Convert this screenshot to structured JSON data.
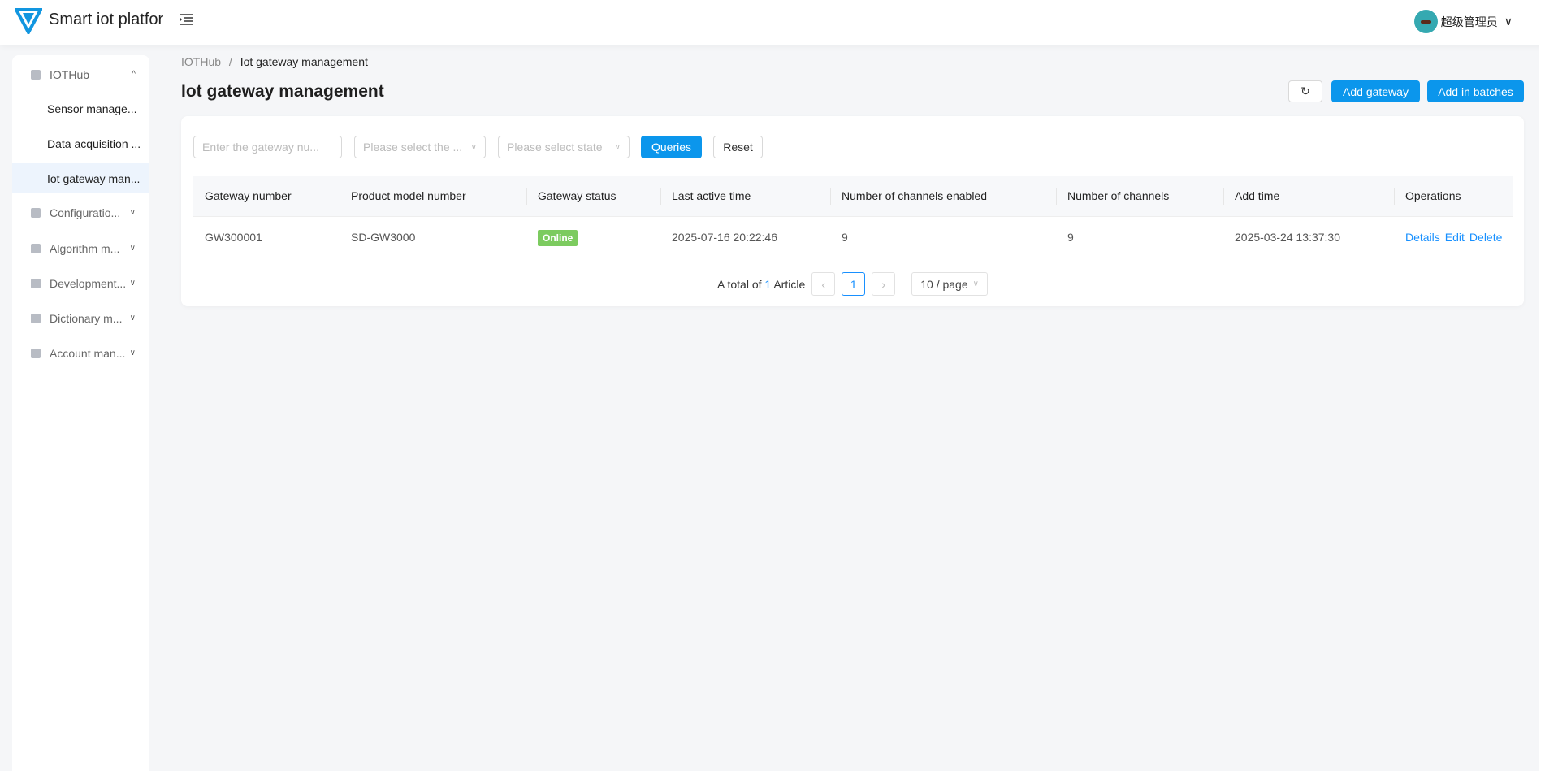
{
  "app": {
    "title": "Smart iot platfor",
    "user": "超级管理员"
  },
  "sidebar": {
    "groups": [
      {
        "label": "IOTHub",
        "icon": "grid-icon",
        "expanded": true,
        "items": [
          {
            "label": "Sensor manage..."
          },
          {
            "label": "Data acquisition ..."
          },
          {
            "label": "Iot gateway man...",
            "selected": true
          }
        ]
      },
      {
        "label": "Configuratio...",
        "icon": "config-icon"
      },
      {
        "label": "Algorithm m...",
        "icon": "algorithm-icon"
      },
      {
        "label": "Development...",
        "icon": "development-icon"
      },
      {
        "label": "Dictionary m...",
        "icon": "dictionary-icon"
      },
      {
        "label": "Account man...",
        "icon": "account-icon"
      }
    ]
  },
  "breadcrumb": {
    "parent": "IOTHub",
    "sep": "/",
    "current": "Iot gateway management"
  },
  "page": {
    "title": "Iot gateway management",
    "refresh": "↻",
    "add": "Add gateway",
    "batch": "Add in batches"
  },
  "filters": {
    "gateway_placeholder": "Enter the gateway nu...",
    "model_placeholder": "Please select the ...",
    "state_placeholder": "Please select state",
    "query": "Queries",
    "reset": "Reset"
  },
  "table": {
    "columns": [
      "Gateway number",
      "Product model number",
      "Gateway status",
      "Last active time",
      "Number of channels enabled",
      "Number of channels",
      "Add time",
      "Operations"
    ],
    "rows": [
      {
        "gateway": "GW300001",
        "model": "SD-GW3000",
        "status": "Online",
        "last_active": "2025-07-16 20:22:46",
        "enabled": "9",
        "channels": "9",
        "add_time": "2025-03-24 13:37:30",
        "ops": [
          "Details",
          "Edit",
          "Delete"
        ]
      }
    ]
  },
  "pagination": {
    "prefix": "A total of",
    "total": "1",
    "suffix": "Article",
    "page": "1",
    "size": "10 / page"
  },
  "colors": {
    "primary": "#0b96ec",
    "online": "#7ccb5f",
    "link": "#1890ff"
  }
}
